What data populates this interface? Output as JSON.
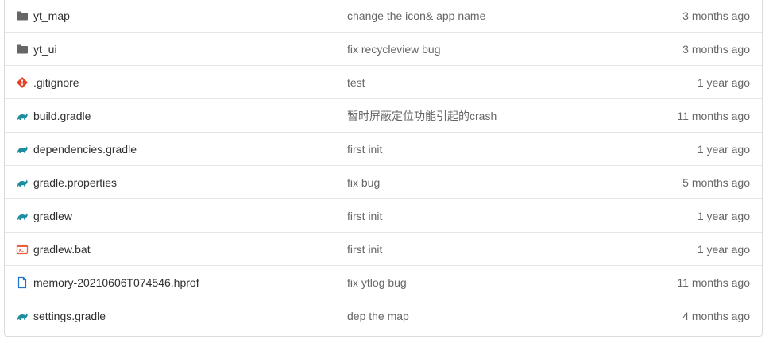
{
  "rows": [
    {
      "icon": "folder-icon",
      "name": "yt_map",
      "commit": "change the icon& app name",
      "time": "3 months ago"
    },
    {
      "icon": "folder-icon",
      "name": "yt_ui",
      "commit": "fix recycleview bug",
      "time": "3 months ago"
    },
    {
      "icon": "git-icon",
      "name": ".gitignore",
      "commit": "test",
      "time": "1 year ago"
    },
    {
      "icon": "gradle-icon",
      "name": "build.gradle",
      "commit": "暂时屏蔽定位功能引起的crash",
      "time": "11 months ago"
    },
    {
      "icon": "gradle-icon",
      "name": "dependencies.gradle",
      "commit": "first init",
      "time": "1 year ago"
    },
    {
      "icon": "gradle-icon",
      "name": "gradle.properties",
      "commit": "fix bug",
      "time": "5 months ago"
    },
    {
      "icon": "gradle-icon",
      "name": "gradlew",
      "commit": "first init",
      "time": "1 year ago"
    },
    {
      "icon": "terminal-icon",
      "name": "gradlew.bat",
      "commit": "first init",
      "time": "1 year ago"
    },
    {
      "icon": "file-icon",
      "name": "memory-20210606T074546.hprof",
      "commit": "fix ytlog bug",
      "time": "11 months ago"
    },
    {
      "icon": "gradle-icon",
      "name": "settings.gradle",
      "commit": "dep the map",
      "time": "4 months ago"
    }
  ],
  "colors": {
    "folder": "#666666",
    "git": "#e24329",
    "gradle": "#02303a",
    "gradle_teal": "#1f8ca0",
    "terminal": "#e8603c",
    "file": "#1f75cb"
  }
}
